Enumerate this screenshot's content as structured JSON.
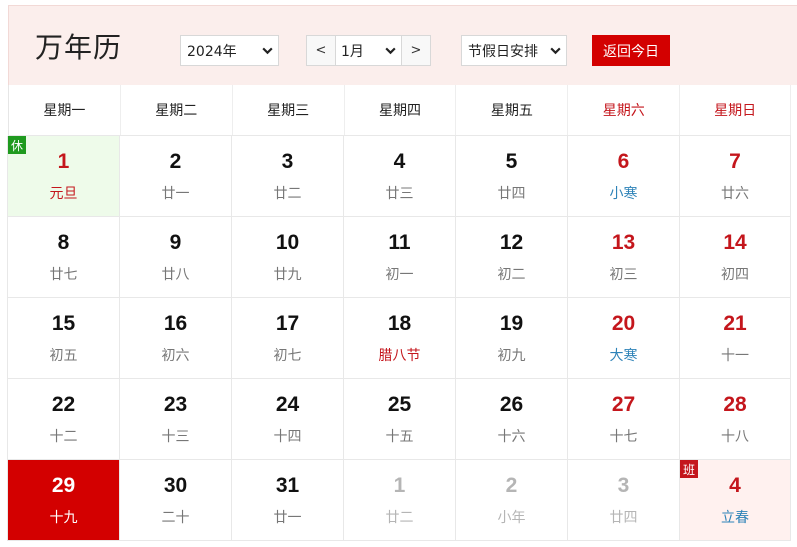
{
  "header": {
    "title": "万年历",
    "year_value": "2024年",
    "month_prev": "<",
    "month_value": "1月",
    "month_next": ">",
    "holiday_value": "节假日安排",
    "today_label": "返回今日"
  },
  "weekdays": [
    "星期一",
    "星期二",
    "星期三",
    "星期四",
    "星期五",
    "星期六",
    "星期日"
  ],
  "weeks": [
    [
      {
        "day": "1",
        "lunar": "元旦",
        "red": true,
        "festival": true,
        "rest": true,
        "badge": "休"
      },
      {
        "day": "2",
        "lunar": "廿一"
      },
      {
        "day": "3",
        "lunar": "廿二"
      },
      {
        "day": "4",
        "lunar": "廿三"
      },
      {
        "day": "5",
        "lunar": "廿四"
      },
      {
        "day": "6",
        "lunar": "小寒",
        "red": true,
        "term": true
      },
      {
        "day": "7",
        "lunar": "廿六",
        "red": true
      }
    ],
    [
      {
        "day": "8",
        "lunar": "廿七"
      },
      {
        "day": "9",
        "lunar": "廿八"
      },
      {
        "day": "10",
        "lunar": "廿九"
      },
      {
        "day": "11",
        "lunar": "初一"
      },
      {
        "day": "12",
        "lunar": "初二"
      },
      {
        "day": "13",
        "lunar": "初三",
        "red": true
      },
      {
        "day": "14",
        "lunar": "初四",
        "red": true
      }
    ],
    [
      {
        "day": "15",
        "lunar": "初五"
      },
      {
        "day": "16",
        "lunar": "初六"
      },
      {
        "day": "17",
        "lunar": "初七"
      },
      {
        "day": "18",
        "lunar": "腊八节",
        "festival": true
      },
      {
        "day": "19",
        "lunar": "初九"
      },
      {
        "day": "20",
        "lunar": "大寒",
        "red": true,
        "term": true
      },
      {
        "day": "21",
        "lunar": "十一",
        "red": true
      }
    ],
    [
      {
        "day": "22",
        "lunar": "十二"
      },
      {
        "day": "23",
        "lunar": "十三"
      },
      {
        "day": "24",
        "lunar": "十四"
      },
      {
        "day": "25",
        "lunar": "十五"
      },
      {
        "day": "26",
        "lunar": "十六"
      },
      {
        "day": "27",
        "lunar": "十七",
        "red": true
      },
      {
        "day": "28",
        "lunar": "十八",
        "red": true
      }
    ],
    [
      {
        "day": "29",
        "lunar": "十九",
        "today": true
      },
      {
        "day": "30",
        "lunar": "二十"
      },
      {
        "day": "31",
        "lunar": "廿一"
      },
      {
        "day": "1",
        "lunar": "廿二",
        "other": true
      },
      {
        "day": "2",
        "lunar": "小年",
        "other": true
      },
      {
        "day": "3",
        "lunar": "廿四",
        "other": true
      },
      {
        "day": "4",
        "lunar": "立春",
        "red": true,
        "term": true,
        "work": true,
        "badge": "班"
      }
    ]
  ],
  "colors": {
    "accent": "#d30000",
    "weekend": "#c4161c",
    "solar_term": "#2e83b8",
    "rest_bg": "#eefbea",
    "work_bg": "#fff1ef"
  }
}
